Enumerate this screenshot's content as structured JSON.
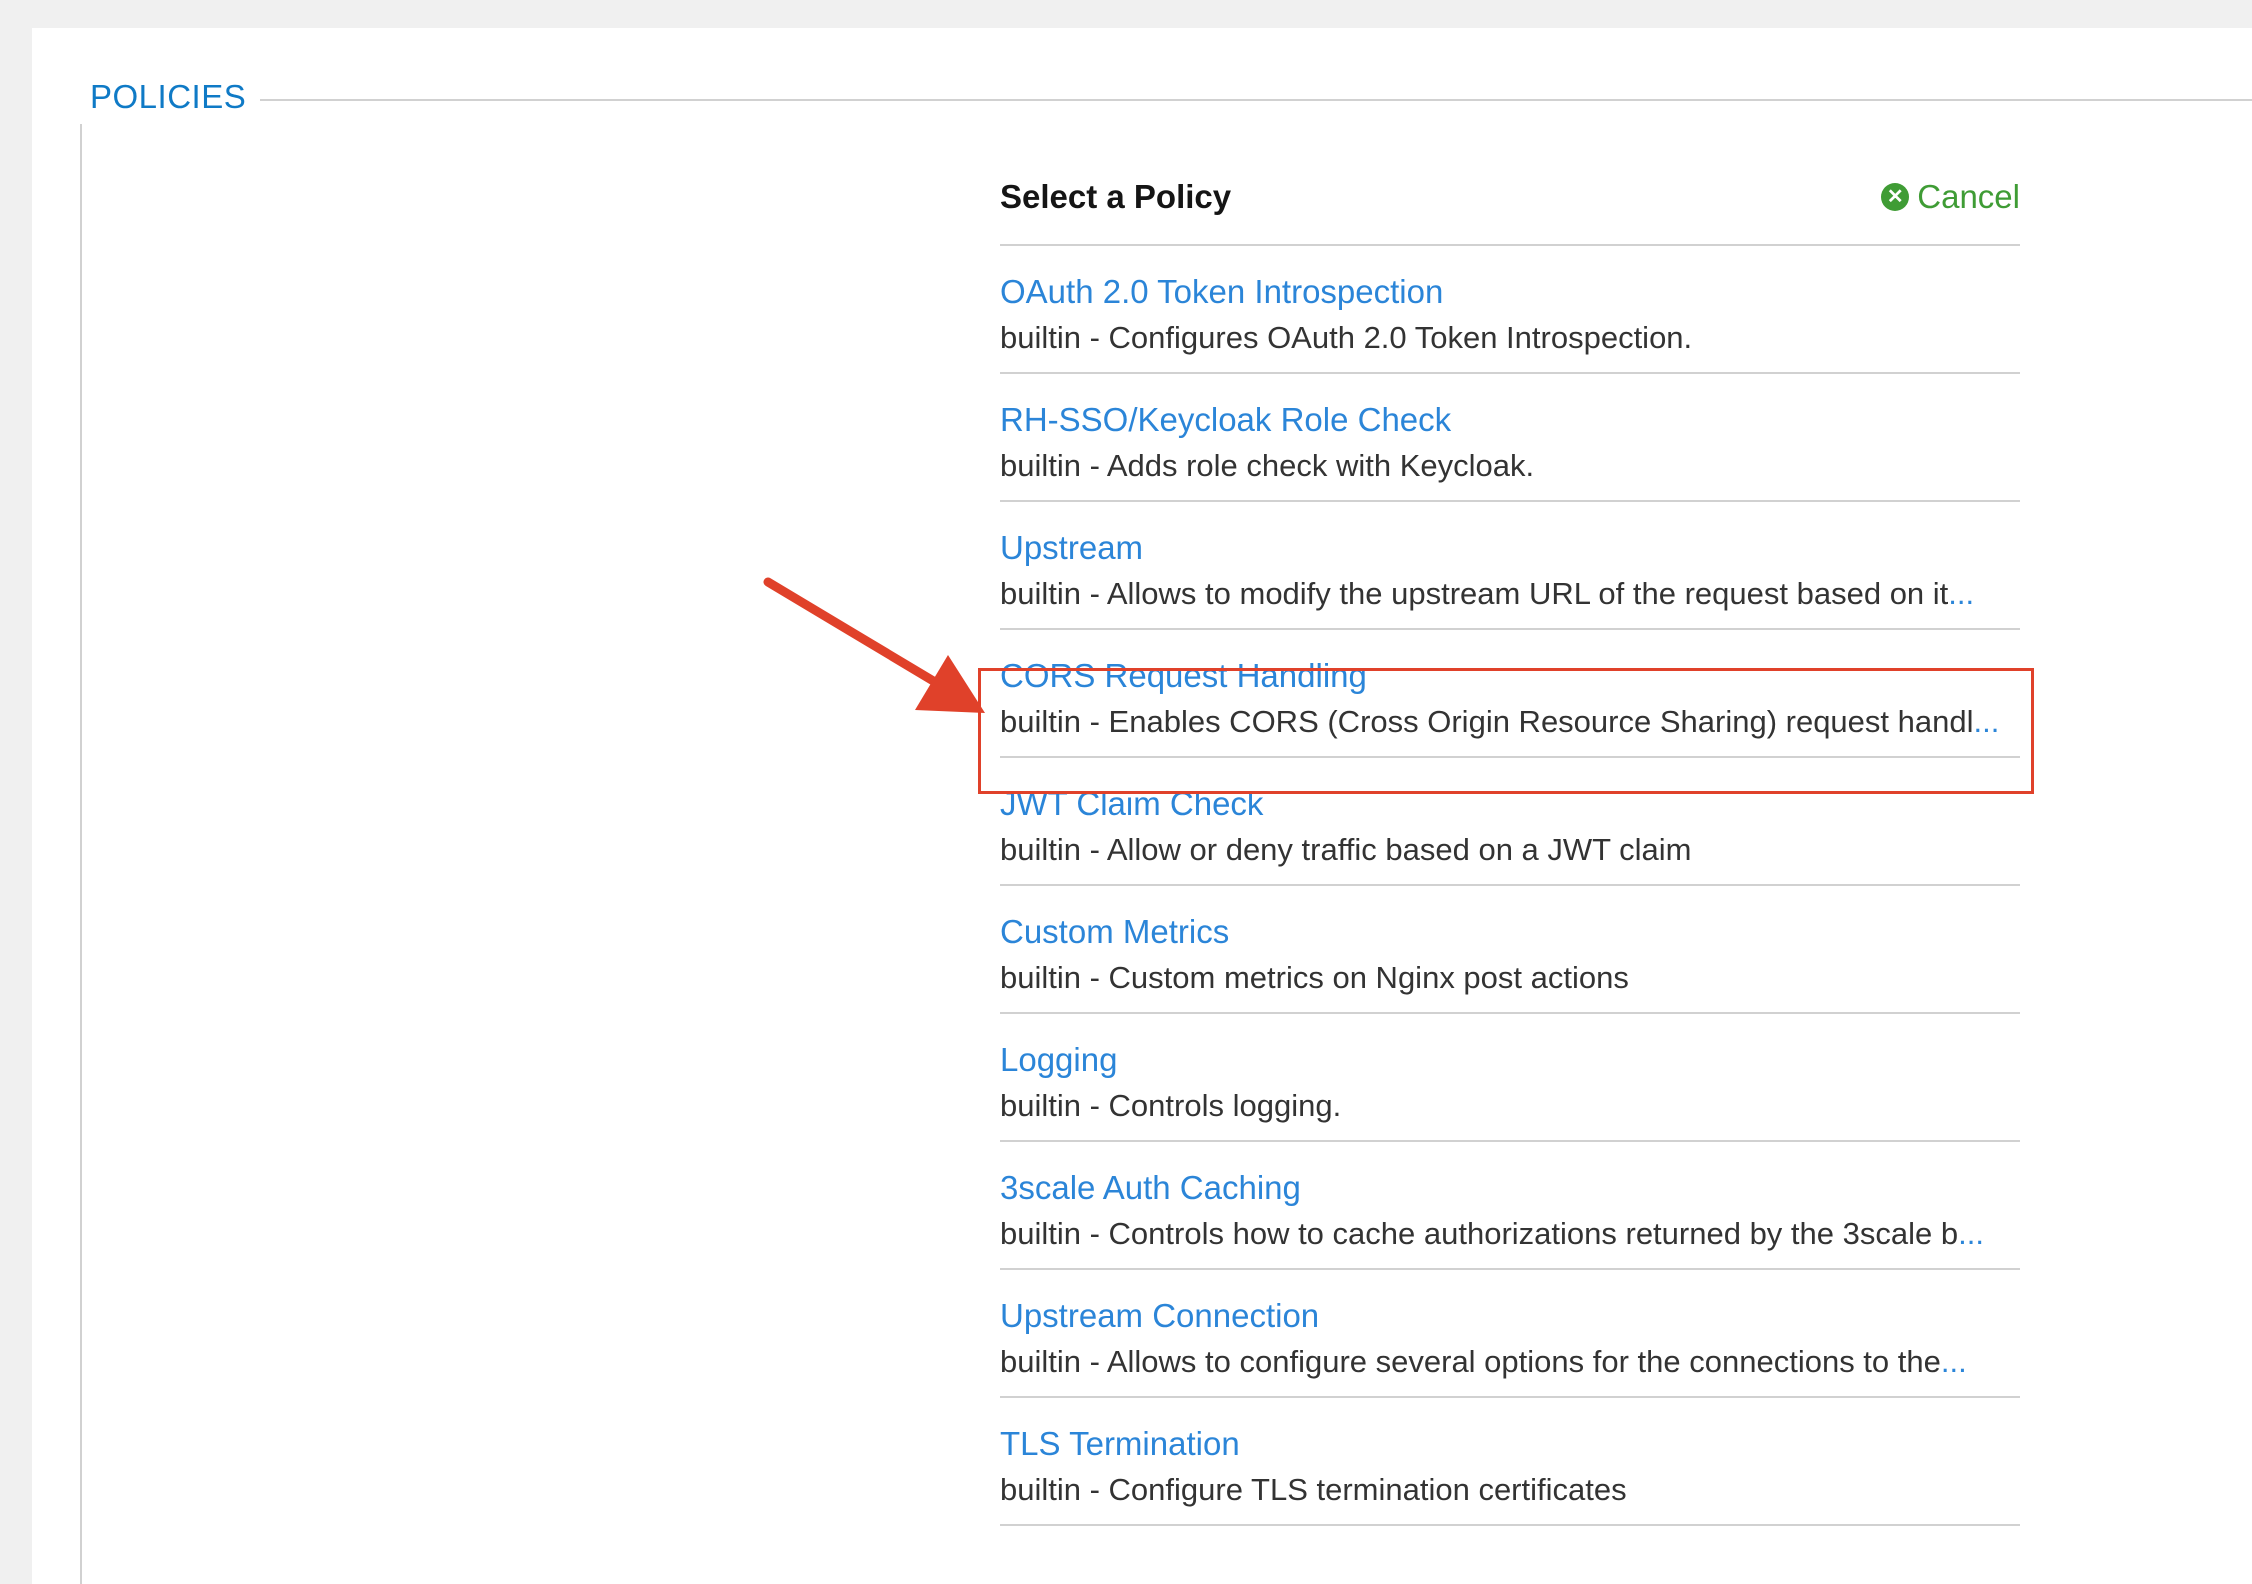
{
  "fieldset": {
    "legend": "POLICIES"
  },
  "panel": {
    "title": "Select a Policy",
    "cancel_label": "Cancel"
  },
  "policies": [
    {
      "name": "OAuth 2.0 Token Introspection",
      "description": "builtin - Configures OAuth 2.0 Token Introspection.",
      "truncated": false
    },
    {
      "name": "RH-SSO/Keycloak Role Check",
      "description": "builtin - Adds role check with Keycloak.",
      "truncated": false
    },
    {
      "name": "Upstream",
      "description": "builtin - Allows to modify the upstream URL of the request based on it",
      "truncated": true
    },
    {
      "name": "CORS Request Handling",
      "description": "builtin - Enables CORS (Cross Origin Resource Sharing) request handl",
      "truncated": true
    },
    {
      "name": "JWT Claim Check",
      "description": "builtin - Allow or deny traffic based on a JWT claim",
      "truncated": false
    },
    {
      "name": "Custom Metrics",
      "description": "builtin - Custom metrics on Nginx post actions",
      "truncated": false
    },
    {
      "name": "Logging",
      "description": "builtin - Controls logging.",
      "truncated": false
    },
    {
      "name": "3scale Auth Caching",
      "description": "builtin - Controls how to cache authorizations returned by the 3scale b",
      "truncated": true
    },
    {
      "name": "Upstream Connection",
      "description": "builtin - Allows to configure several options for the connections to the ",
      "truncated": true
    },
    {
      "name": "TLS Termination",
      "description": "builtin - Configure TLS termination certificates",
      "truncated": false
    }
  ],
  "ellipsis": "...",
  "annotation": {
    "highlighted_policy": "CORS Request Handling",
    "color": "#e0412a"
  }
}
